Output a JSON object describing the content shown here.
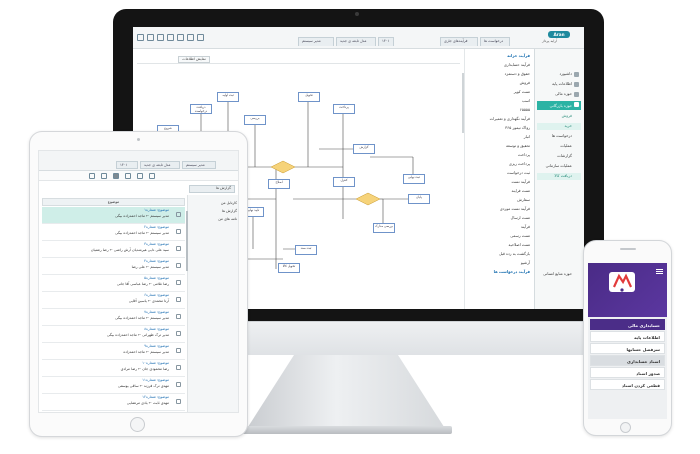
{
  "imac": {
    "tabs": [
      "مدیر سیستم",
      "مدل تابعه ی جدید",
      "۱۴۰۱",
      "فرآیندهای جاری",
      "درخواست ها"
    ],
    "logo": {
      "badge": "Aran",
      "text": "آرایه پرداز"
    },
    "toolbar": {
      "button": "نمایش اطلاعات"
    },
    "sidebar": [
      "داشبورد",
      "اطلاعات پایه",
      "حوزه مالی",
      "حوزه بازرگانی",
      "فروش",
      "خرید",
      "درخواست ها",
      "عملیات",
      "گزارشات",
      "عملیات سازمانی",
      "دریافت کالا",
      "حوزه منابع انسانی"
    ],
    "menu": [
      "فرآیند خزانه",
      "فرآیند حسابداری",
      "حقوق و دستمزد",
      "فروش",
      "تست کوپر",
      "اسب",
      "۶۵۵۵۵",
      "فرآیند نگهداری و تعمیرات",
      "رواک تیمور ۳۶۵",
      "انبار",
      "تحقیق و توسعه",
      "پرداخت",
      "پرداخت ریزی",
      "ثبت درخواست",
      "فرآیند تست",
      "تست فرایند",
      "سفارش",
      "فرآیند تست موردی",
      "تست ارسال",
      "فرآیند",
      "تست رسمی",
      "تست اصلاحیه",
      "بازگشت به رده قبل",
      "آرشیو",
      "فرآیند درخواست ها"
    ],
    "nodes": [
      "شروع",
      "دریافت درخواست",
      "ثبت اولیه",
      "بررسی",
      "تایید",
      "ارسال",
      "تحویل",
      "پرداخت",
      "گزارش",
      "ثبت نهایی",
      "کنترل",
      "پایان",
      "بررسی مدارک",
      "اصلاح",
      "تایید نهایی",
      "درخواست خرید",
      "ثبت سند",
      "تحویل کالا"
    ]
  },
  "ipad": {
    "tabs": [
      "مدیر سیستم",
      "مدل تابعه ی جدید",
      "۱۴۰۱"
    ],
    "subtab": "گزارش ها",
    "header": "موضوع",
    "side": [
      "کارتابل من",
      "گزارش ها",
      "نامه های من"
    ],
    "rows": [
      {
        "title": "موضوع: شماره۱",
        "sub": "مدیر سیستم ← ماجد احمدزاده بیگی"
      },
      {
        "title": "موضوع: شماره۲",
        "sub": "مدیر سیستم ← ماجد احمدزاده بیگی"
      },
      {
        "title": "موضوع: شماره۳",
        "sub": "سید علی دایی هیرمندیان آرش راضی ← رضا رشتیان"
      },
      {
        "title": "موضوع: شماره۴",
        "sub": "مدیر سیستم ← علی رضا"
      },
      {
        "title": "موضوع: شماره۵",
        "sub": "رضا غلامی ← رضا عباسی آقا جانی"
      },
      {
        "title": "موضوع: شماره۶",
        "sub": "آرتا محمدی ← یاسین آقایی"
      },
      {
        "title": "موضوع: شماره۷",
        "sub": "مدیر سیستم ← ماجد احمدزاده بیگی"
      },
      {
        "title": "موضوع: شماره۸",
        "sub": "مدیر ترک ظهرانی ← ماجد احمدزاده بیگی"
      },
      {
        "title": "موضوع: شماره۹",
        "sub": "مدیر سیستم ← ماجد احمدزاده"
      },
      {
        "title": "موضوع: شماره۱۰",
        "sub": "رضا محمودی جان ← رضا مرادی"
      },
      {
        "title": "موضوع: شماره۱۱",
        "sub": "مهدی ترک فرزند ← ساقی یوسفی"
      },
      {
        "title": "موضوع: شماره۱۲",
        "sub": "مهدی ثابت ← یادی مرتضایی"
      }
    ]
  },
  "iphone": {
    "items": [
      "حسابداری مالی",
      "اطلاعات پایه",
      "سرفصل حسابها",
      "اسناد حسابداری",
      "صدور اسناد",
      "قطعی کردن اسناد"
    ]
  },
  "colors": {
    "accent": "#2bb3a4",
    "brand": "#1f8a9e",
    "phone_brand": "#4b2d88",
    "node_border": "#6f93c9",
    "diamond": "#f2c05b"
  }
}
